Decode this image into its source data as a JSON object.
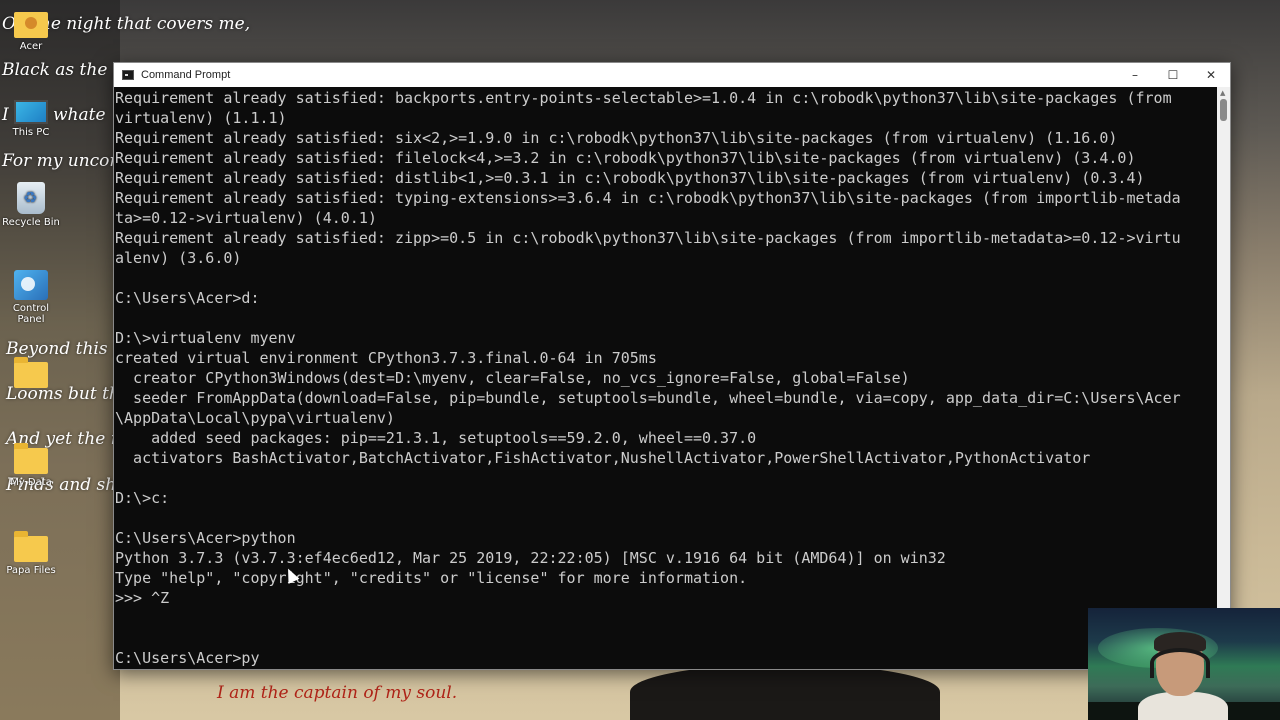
{
  "desktop": {
    "poem": [
      "O   f the night that covers me,",
      "Black as the pi",
      "I th   k whate",
      "For my uncon",
      "Beyond this p",
      "Looms but th",
      "And yet the m",
      "Finds and sh"
    ],
    "poem_bottom": "I am the captain of my soul.",
    "icons": [
      {
        "label": "Acer",
        "icon": "user-folder-icon"
      },
      {
        "label": "This PC",
        "icon": "this-pc-icon"
      },
      {
        "label": "Recycle Bin",
        "icon": "recycle-bin-icon"
      },
      {
        "label": "Control Panel",
        "icon": "control-panel-icon"
      },
      {
        "label": "",
        "icon": "folder-icon"
      },
      {
        "label": "My Data",
        "icon": "folder-icon"
      },
      {
        "label": "Papa Files",
        "icon": "folder-icon"
      }
    ]
  },
  "window": {
    "title": "Command Prompt",
    "minimize": "–",
    "maximize": "☐",
    "close": "✕"
  },
  "console": {
    "lines": [
      "Requirement already satisfied: backports.entry-points-selectable>=1.0.4 in c:\\robodk\\python37\\lib\\site-packages (from",
      "virtualenv) (1.1.1)",
      "Requirement already satisfied: six<2,>=1.9.0 in c:\\robodk\\python37\\lib\\site-packages (from virtualenv) (1.16.0)",
      "Requirement already satisfied: filelock<4,>=3.2 in c:\\robodk\\python37\\lib\\site-packages (from virtualenv) (3.4.0)",
      "Requirement already satisfied: distlib<1,>=0.3.1 in c:\\robodk\\python37\\lib\\site-packages (from virtualenv) (0.3.4)",
      "Requirement already satisfied: typing-extensions>=3.6.4 in c:\\robodk\\python37\\lib\\site-packages (from importlib-metada",
      "ta>=0.12->virtualenv) (4.0.1)",
      "Requirement already satisfied: zipp>=0.5 in c:\\robodk\\python37\\lib\\site-packages (from importlib-metadata>=0.12->virtu",
      "alenv) (3.6.0)",
      "",
      "C:\\Users\\Acer>d:",
      "",
      "D:\\>virtualenv myenv",
      "created virtual environment CPython3.7.3.final.0-64 in 705ms",
      "  creator CPython3Windows(dest=D:\\myenv, clear=False, no_vcs_ignore=False, global=False)",
      "  seeder FromAppData(download=False, pip=bundle, setuptools=bundle, wheel=bundle, via=copy, app_data_dir=C:\\Users\\Acer",
      "\\AppData\\Local\\pypa\\virtualenv)",
      "    added seed packages: pip==21.3.1, setuptools==59.2.0, wheel==0.37.0",
      "  activators BashActivator,BatchActivator,FishActivator,NushellActivator,PowerShellActivator,PythonActivator",
      "",
      "D:\\>c:",
      "",
      "C:\\Users\\Acer>python",
      "Python 3.7.3 (v3.7.3:ef4ec6ed12, Mar 25 2019, 22:22:05) [MSC v.1916 64 bit (AMD64)] on win32",
      "Type \"help\", \"copyright\", \"credits\" or \"license\" for more information.",
      ">>> ^Z",
      "",
      "",
      "C:\\Users\\Acer>py"
    ]
  }
}
